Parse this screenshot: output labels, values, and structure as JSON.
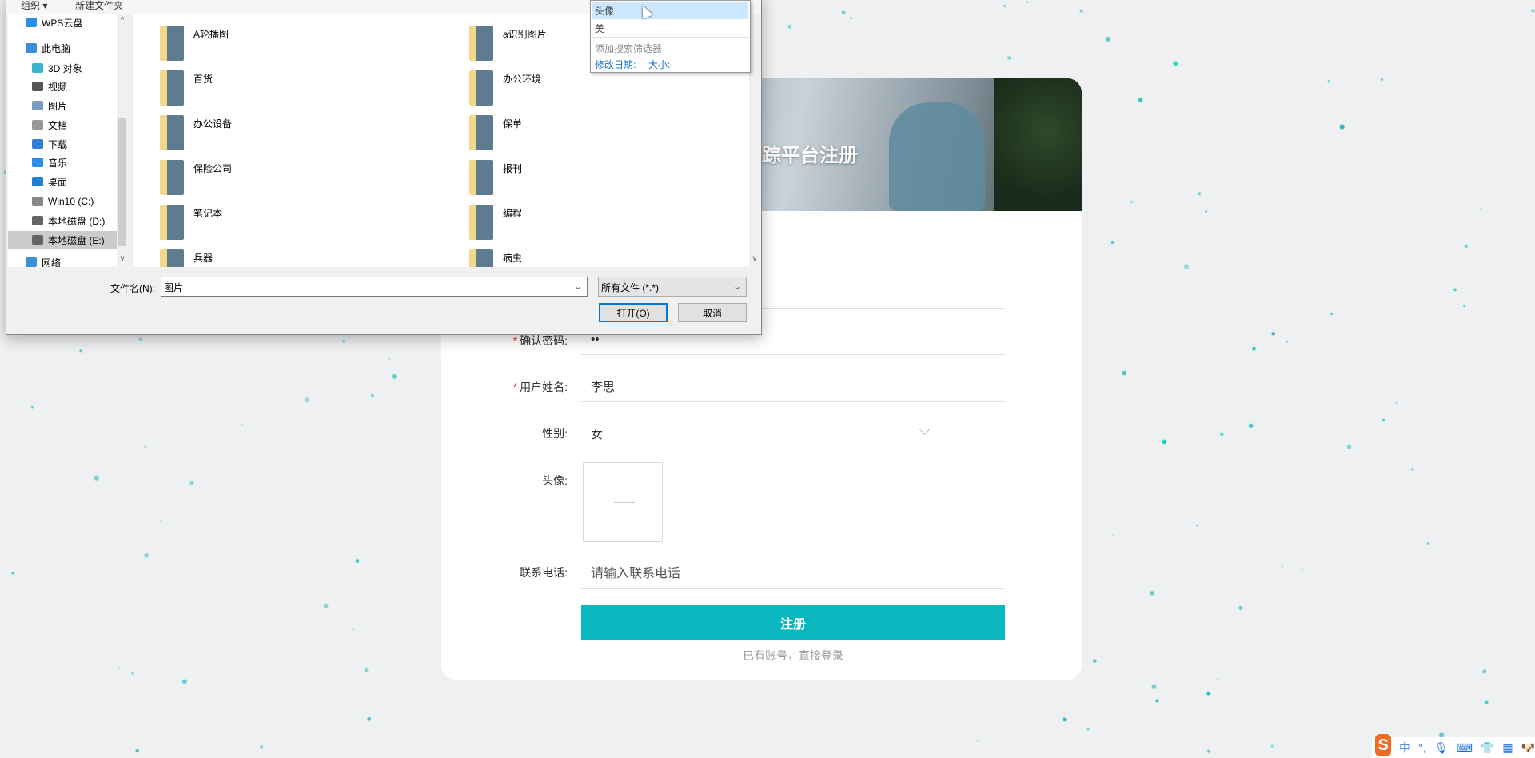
{
  "page": {
    "accent": "#0bb7bf",
    "banner_title": "踪平台注册"
  },
  "form": {
    "confirm_password": {
      "label": "确认密码:",
      "value": "••"
    },
    "username": {
      "label": "用户姓名:",
      "value": "李思"
    },
    "gender": {
      "label": "性别:",
      "value": "女"
    },
    "avatar": {
      "label": "头像:"
    },
    "phone": {
      "label": "联系电话:",
      "placeholder": "请输入联系电话"
    },
    "submit_label": "注册",
    "login_link": "已有账号，直接登录"
  },
  "dialog": {
    "toolbar": {
      "organize": "组织 ▾",
      "new_folder": "新建文件夹"
    },
    "sidebar": [
      {
        "label": "WPS云盘",
        "icon": "cloud-icon",
        "color": "#2a8ee8"
      },
      {
        "label": "此电脑",
        "icon": "computer-icon",
        "color": "#3a8fd8"
      },
      {
        "label": "3D 对象",
        "icon": "cube-icon",
        "color": "#35b5d0"
      },
      {
        "label": "视频",
        "icon": "film-icon",
        "color": "#555"
      },
      {
        "label": "图片",
        "icon": "picture-icon",
        "color": "#7a9cc0"
      },
      {
        "label": "文档",
        "icon": "document-icon",
        "color": "#999"
      },
      {
        "label": "下载",
        "icon": "download-icon",
        "color": "#2f7fd8"
      },
      {
        "label": "音乐",
        "icon": "music-icon",
        "color": "#2a8ee8"
      },
      {
        "label": "桌面",
        "icon": "desktop-icon",
        "color": "#1f7fd0"
      },
      {
        "label": "Win10 (C:)",
        "icon": "drive-icon",
        "color": "#888"
      },
      {
        "label": "本地磁盘 (D:)",
        "icon": "drive-icon",
        "color": "#666"
      },
      {
        "label": "本地磁盘 (E:)",
        "icon": "drive-icon",
        "color": "#666",
        "selected": true
      },
      {
        "label": "网络",
        "icon": "network-icon",
        "color": "#3a8fd8"
      }
    ],
    "folders": [
      "A轮播图",
      "a识别图片",
      "百货",
      "办公环境",
      "办公设备",
      "保单",
      "保险公司",
      "报刊",
      "笔记本",
      "编程",
      "兵器",
      "病虫"
    ],
    "filename_label": "文件名(N):",
    "filename_value": "图片",
    "filetype_value": "所有文件 (*.*)",
    "open_label": "打开(O)",
    "cancel_label": "取消",
    "suggestions": [
      "头像",
      "美"
    ],
    "add_filter": "添加搜索筛选器",
    "filter_date": "修改日期:",
    "filter_size": "大小:"
  },
  "ime": {
    "mode": "中",
    "punct": "°,"
  }
}
